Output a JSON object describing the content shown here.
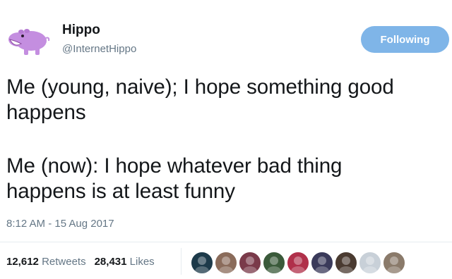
{
  "tweet": {
    "author": {
      "display_name": "Hippo",
      "handle": "@InternetHippo",
      "avatar_icon": "hippo-avatar-icon"
    },
    "follow_button": {
      "label": "Following",
      "color": "#7fb5e8"
    },
    "text_lines": [
      "Me (young, naive); I hope something good",
      "happens",
      "Me (now): I hope whatever bad thing",
      "happens is at least funny"
    ],
    "timestamp": "8:12 AM - 15 Aug 2017",
    "stats": {
      "retweets_count": "12,612",
      "retweets_label": "Retweets",
      "likes_count": "28,431",
      "likes_label": "Likes"
    },
    "likers": [
      {
        "color": "#1d3a4a"
      },
      {
        "color": "#8a6b5a"
      },
      {
        "color": "#7a3a4a"
      },
      {
        "color": "#3a5a3a"
      },
      {
        "color": "#b0304a"
      },
      {
        "color": "#3a3a5a"
      },
      {
        "color": "#4a3a30"
      },
      {
        "color": "#c8d0d8"
      },
      {
        "color": "#8a7a6a"
      }
    ]
  }
}
